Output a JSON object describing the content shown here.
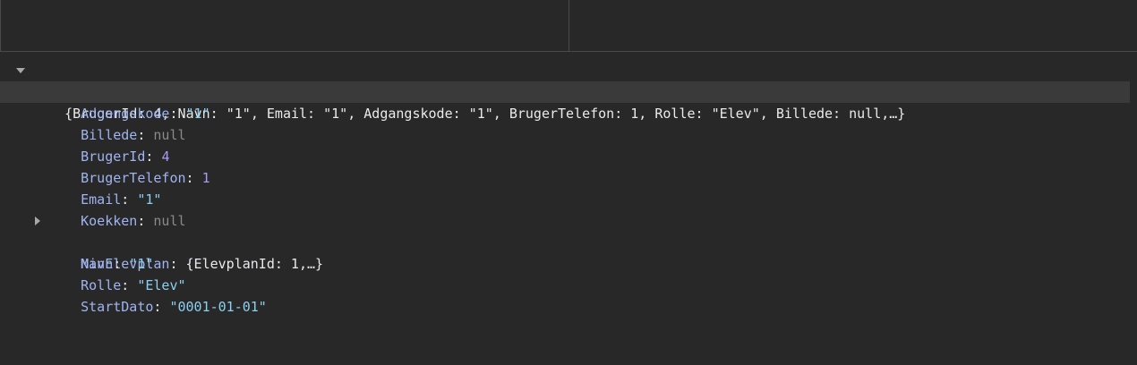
{
  "summary": "{BrugerId: 4, Navn: \"1\", Email: \"1\", Adgangskode: \"1\", BrugerTelefon: 1, Rolle: \"Elev\", Billede: null,…}",
  "properties": [
    {
      "key": "Adgangskode",
      "value": "\"1\"",
      "type": "string"
    },
    {
      "key": "Billede",
      "value": "null",
      "type": "null"
    },
    {
      "key": "BrugerId",
      "value": "4",
      "type": "number"
    },
    {
      "key": "BrugerTelefon",
      "value": "1",
      "type": "number"
    },
    {
      "key": "Email",
      "value": "\"1\"",
      "type": "string"
    },
    {
      "key": "Koekken",
      "value": "null",
      "type": "null"
    },
    {
      "key": "MinElevplan",
      "value": "{ElevplanId: 1,…}",
      "type": "object"
    },
    {
      "key": "Navn",
      "value": "\"1\"",
      "type": "string"
    },
    {
      "key": "Rolle",
      "value": "\"Elev\"",
      "type": "string"
    },
    {
      "key": "StartDato",
      "value": "\"0001-01-01\"",
      "type": "string"
    }
  ],
  "separator": ": ",
  "colors": {
    "background": "#282828",
    "key": "#9fb4f0",
    "string": "#8ad0ef",
    "number": "#a99bf3",
    "null": "#8a8a8a",
    "highlight": "#3a3a3a"
  },
  "icons": {
    "expanded": "triangle-down-icon",
    "collapsed": "triangle-right-icon"
  }
}
